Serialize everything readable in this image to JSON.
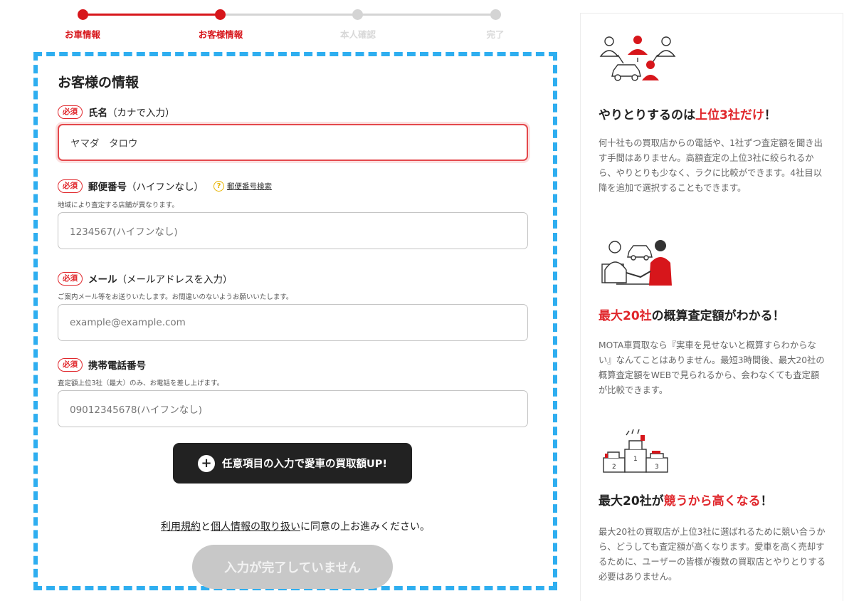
{
  "stepper": {
    "steps": [
      {
        "label": "お車情報",
        "state": "done"
      },
      {
        "label": "お客様情報",
        "state": "current"
      },
      {
        "label": "本人確認",
        "state": "todo"
      },
      {
        "label": "完了",
        "state": "todo"
      }
    ],
    "colors": {
      "active": "#d7161b",
      "inactive": "#d4d4d4",
      "inactive_text": "#dcdcdc"
    }
  },
  "form": {
    "title": "お客様の情報",
    "required_badge": "必須",
    "name": {
      "label": "氏名",
      "label_note": "（カナで入力）",
      "value": "ヤマダ　タロウ"
    },
    "postal": {
      "label": "郵便番号",
      "label_note": "（ハイフンなし）",
      "help_icon": "question-circle-icon",
      "help_link": "郵便番号検索",
      "note": "地域により査定する店舗が異なります。",
      "placeholder": "1234567(ハイフンなし)"
    },
    "email": {
      "label": "メール",
      "label_note": "（メールアドレスを入力）",
      "note": "ご案内メール等をお送りいたします。お間違いのないようお願いいたします。",
      "placeholder": "example@example.com"
    },
    "phone": {
      "label": "携帯電話番号",
      "note": "査定額上位3社（最大）のみ、お電話を差し上げます。",
      "placeholder": "09012345678(ハイフンなし)"
    },
    "option_button": {
      "icon": "plus-circle-icon",
      "label": "任意項目の入力で愛車の買取額UP!"
    },
    "consent": {
      "terms_link": "利用規約",
      "and": "と",
      "privacy_link": "個人情報の取り扱い",
      "suffix": "に同意の上お進みください。"
    },
    "submit": {
      "label": "入力が完了していません",
      "state": "disabled"
    },
    "colors": {
      "required": "#e0262b",
      "error_border": "#e4484c",
      "dashed_frame": "#2eaef0"
    }
  },
  "features": [
    {
      "illustration": "people-negotiation-illustration",
      "title_parts": [
        "やりとりするのは",
        "上位3社だけ",
        "！"
      ],
      "body": "何十社もの買取店からの電話や、1社ずつ査定額を聞き出す手間はありません。高額査定の上位3社に絞られるから、やりとりも少なく、ラクに比較ができます。4社目以降を追加で選択することもできます。"
    },
    {
      "illustration": "handshake-car-illustration",
      "title_parts": [
        "",
        "最大20社",
        "の概算査定額がわかる！"
      ],
      "body": "MOTA車買取なら『実車を見せないと概算すらわからない』なんてことはありません。最短3時間後、最大20社の概算査定額をWEBで見られるから、会わなくても査定額が比較できます。"
    },
    {
      "illustration": "ranking-podium-illustration",
      "title_parts": [
        "最大20社が",
        "競うから高くなる",
        "！"
      ],
      "body": "最大20社の買取店が上位3社に選ばれるために競い合うから、どうしても査定額が高くなります。愛車を高く売却するために、ユーザーの皆様が複数の買取店とやりとりする必要はありません。",
      "podium_numbers": [
        "1",
        "2",
        "3"
      ]
    }
  ]
}
